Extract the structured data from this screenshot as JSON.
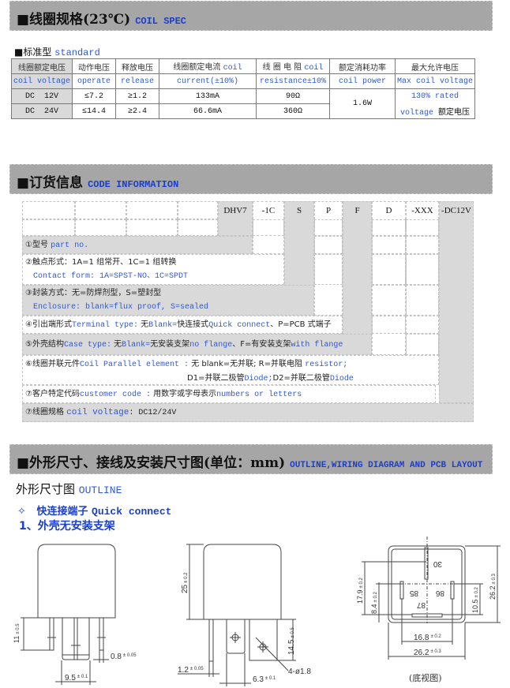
{
  "coil_spec": {
    "title_cn": "■线圈规格(23℃)",
    "title_en": "COIL SPEC",
    "subtitle_cn": "■标准型",
    "subtitle_en": "standard",
    "headers": [
      {
        "cn": "线圈额定电压",
        "en": "coil voltage"
      },
      {
        "cn": "动作电压",
        "en": "operate"
      },
      {
        "cn": "释放电压",
        "en": "release"
      },
      {
        "cn": "线圈额定电流",
        "cn_en": "coil",
        "en": "current(±10%)"
      },
      {
        "cn": "线 圈 电 阻",
        "cn_en": "coil",
        "en": "resistance±10%"
      },
      {
        "cn": "额定消耗功率",
        "en": "coil power"
      },
      {
        "cn": "最大允许电压",
        "en": "Max coil voltage"
      }
    ],
    "rows": [
      {
        "voltage": "DC  12V",
        "operate": "≤7.2",
        "release": "≥1.2",
        "current": "133mA",
        "resistance": "90Ω"
      },
      {
        "voltage": "DC  24V",
        "operate": "≤14.4",
        "release": "≥2.4",
        "current": "66.6mA",
        "resistance": "360Ω"
      }
    ],
    "power": "1.6W",
    "max_voltage_en1": "130% rated",
    "max_voltage_en2": "voltage",
    "max_voltage_cn": "额定电压"
  },
  "code_info": {
    "title_cn": "■订货信息",
    "title_en": "CODE INFORMATION",
    "codes": [
      "DHV7",
      "-1C",
      "S",
      "P",
      "F",
      "D",
      "-XXX",
      "-DC12V"
    ],
    "items": [
      {
        "label": "①型号",
        "en": "part no."
      },
      {
        "label": "②触点形式：1A=1 组常开、1C=1 组转换",
        "en": "Contact form: 1A=SPST-NO、1C=SPDT"
      },
      {
        "label": "③封装方式：无=防焊剂型，S=塑封型",
        "en": "Enclosure: blank=flux proof, S=sealed"
      },
      {
        "label": "④引出端形式",
        "en": "Terminal type:",
        "rest1": "无",
        "en2": "Blank=",
        "rest2": "快连接式",
        "en3": "Quick connect",
        "rest3": "、P=PCB 式端子"
      },
      {
        "label": "⑤外壳结构",
        "en": "Case type:",
        "rest1": "无",
        "en2": "Blank=",
        "rest2": "无安装支架",
        "en3": "no flange",
        "rest3": "、F=有安装支架",
        "en4": "with flange"
      },
      {
        "label": "⑥线圈并联元件",
        "en": "Coil Parallel element :",
        "rest1": "无 blank=无并联; R=并联电阻",
        "en2": "resistor;",
        "line2a": "D1=并联二极管",
        "line2b": "Diode;",
        "line2c": "D2=并联二极管",
        "line2d": "Diode"
      },
      {
        "label": "⑦客户特定代码",
        "en": "customer code :",
        "rest1": "用数字或字母表示",
        "en2": "numbers or letters"
      },
      {
        "label": "⑦线圈规格",
        "en": "coil voltage",
        "rest1": ": DC12/24V"
      }
    ]
  },
  "outline": {
    "title_cn": "■外形尺寸、接线及安装尺寸图(单位：mm)",
    "title_en": "OUTLINE,WIRING DIAGRAM AND PCB LAYOUT",
    "sub_cn": "外形尺寸图",
    "sub_en": "OUTLINE",
    "bullet": "✧",
    "quick_cn": "快连接端子",
    "quick_en": "Quick connect",
    "item1": "1、外壳无安装支架",
    "bottom_view": "(底视图)",
    "dims": {
      "left_h": "11",
      "left_h_tol": "± 0.5",
      "pin_w": "0.8",
      "pin_w_tol": "± 0.05",
      "pitch": "9.5",
      "pitch_tol": "± 0.1",
      "height": "25",
      "height_tol": "± 0.2",
      "pin_len": "14.5",
      "pin_len_tol": "± 0.5",
      "pin_t": "1.2",
      "pin_t_tol": "± 0.05",
      "tab_w": "6.3",
      "tab_w_tol": "± 0.1",
      "hole": "4-ø1.8",
      "d17": "17.9",
      "d17_tol": "± 0.2",
      "d8": "8.4",
      "d8_tol": "± 0.2",
      "d10": "10.5",
      "d10_tol": "± 0.2",
      "d26v": "26.2",
      "d26v_tol": "± 0.3",
      "d16": "16.8",
      "d16_tol": "± 0.2",
      "d26h": "26.2",
      "d26h_tol": "± 0.3",
      "pin30": "30",
      "pin85": "85",
      "pin86": "86",
      "pin87": "87"
    }
  }
}
